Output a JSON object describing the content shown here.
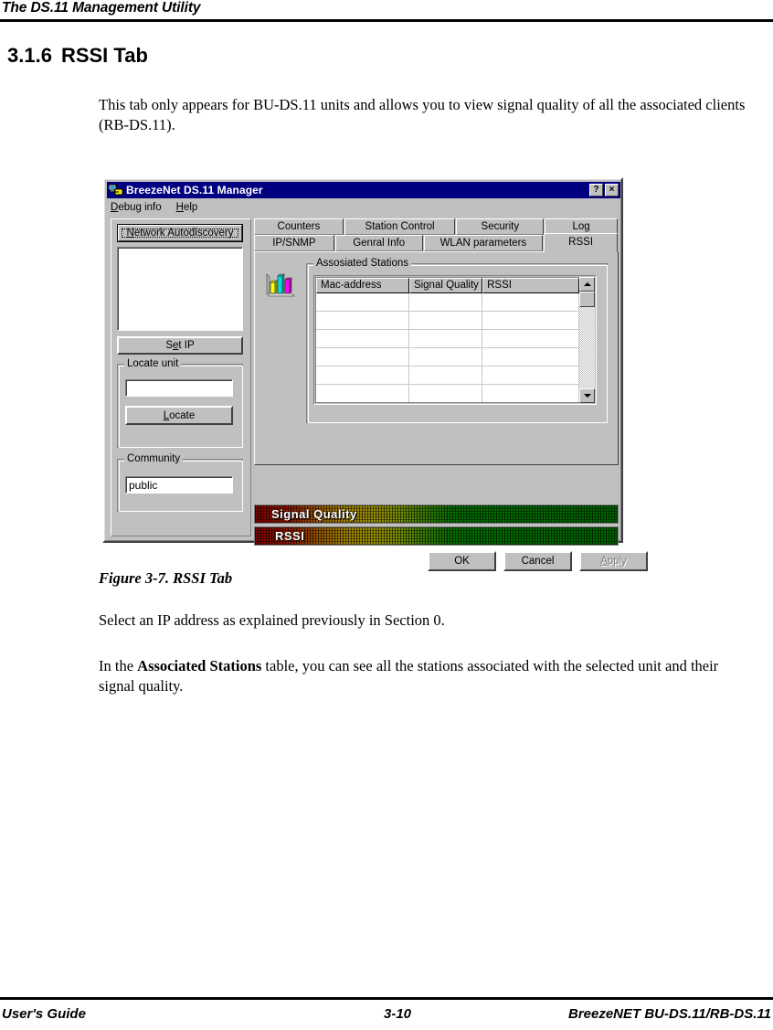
{
  "page": {
    "header_title": "The DS.11 Management Utility",
    "section_number": "3.1.6",
    "section_title": "RSSI Tab",
    "intro_paragraph": "This tab only appears for BU-DS.11 units and allows you to view signal quality of all the associated clients (RB-DS.11).",
    "figure_caption": "Figure 3-7.  RSSI Tab",
    "paragraph_select": "Select an IP address as explained previously in Section 0.",
    "paragraph_assoc_pre": "In the ",
    "paragraph_assoc_bold": "Associated Stations",
    "paragraph_assoc_post": " table, you can see all the stations associated with the selected unit and their signal quality.",
    "footer_left": "User's Guide",
    "footer_middle": "3-10",
    "footer_right": "BreezeNET BU-DS.11/RB-DS.11"
  },
  "dialog": {
    "title": "BreezeNet DS.11 Manager",
    "title_icon": "network-computers-icon",
    "titlebar_buttons": [
      {
        "name": "help-button",
        "label": "?"
      },
      {
        "name": "close-button",
        "label": "×"
      }
    ],
    "menu": [
      {
        "name": "menu-debug-info",
        "label": "Debug info",
        "accel": "D"
      },
      {
        "name": "menu-help",
        "label": "Help",
        "accel": "H"
      }
    ],
    "left_panel": {
      "autodiscovery_button": "Network Autodiscovery",
      "autodiscovery_accel": "N",
      "device_list_items": [],
      "set_ip_button": "Set IP",
      "set_ip_accel": "e",
      "locate_group_label": "Locate unit",
      "locate_input_value": "",
      "locate_button": "Locate",
      "locate_accel": "L",
      "community_group_label": "Community",
      "community_value": "public"
    },
    "tabs_row_top": [
      {
        "name": "tab-counters",
        "label": "Counters",
        "selected": false
      },
      {
        "name": "tab-station-control",
        "label": "Station Control",
        "selected": false
      },
      {
        "name": "tab-security",
        "label": "Security",
        "selected": false
      },
      {
        "name": "tab-log",
        "label": "Log",
        "selected": false
      }
    ],
    "tabs_row_bottom": [
      {
        "name": "tab-ip-snmp",
        "label": "IP/SNMP",
        "selected": false
      },
      {
        "name": "tab-genral-info",
        "label": "Genral Info",
        "selected": false
      },
      {
        "name": "tab-wlan-parameters",
        "label": "WLAN parameters",
        "selected": false
      },
      {
        "name": "tab-rssi",
        "label": "RSSI",
        "selected": true
      }
    ],
    "rssi_panel": {
      "chart_icon": "bar-chart-icon",
      "stations_group_label": "Assosiated Stations",
      "table": {
        "columns": [
          "Mac-address",
          "Signal Quality",
          "RSSI"
        ],
        "rows": [
          [
            "",
            "",
            ""
          ],
          [
            "",
            "",
            ""
          ],
          [
            "",
            "",
            ""
          ],
          [
            "",
            "",
            ""
          ],
          [
            "",
            "",
            ""
          ],
          [
            "",
            "",
            ""
          ]
        ]
      },
      "scrollbar": {
        "up_arrow": "scroll-up-icon",
        "down_arrow": "scroll-down-icon"
      }
    },
    "signal_bars": [
      {
        "name": "signal-quality-bar",
        "label": "Signal Quality",
        "value_percent": 0
      },
      {
        "name": "rssi-bar",
        "label": "RSSI",
        "value_percent": 0
      }
    ],
    "footer_buttons": [
      {
        "name": "ok-button",
        "label": "OK",
        "enabled": true
      },
      {
        "name": "cancel-button",
        "label": "Cancel",
        "enabled": true
      },
      {
        "name": "apply-button",
        "label": "Apply",
        "enabled": false
      }
    ]
  },
  "colors": {
    "titlebar": "#000080",
    "dialog_face": "#c0c0c0",
    "bar_low": "#800000",
    "bar_mid": "#a08000",
    "bar_high": "#006400"
  }
}
